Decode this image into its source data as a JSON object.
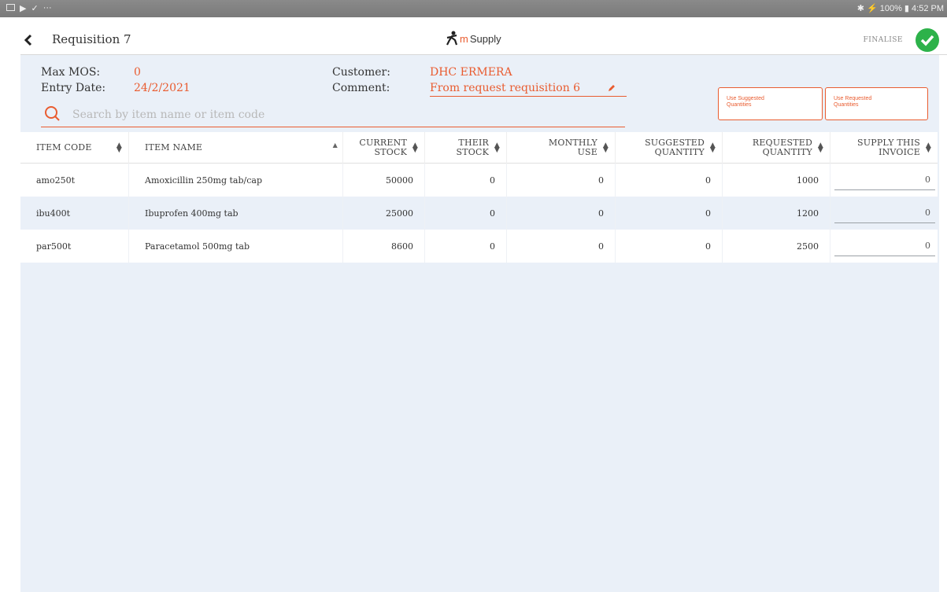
{
  "status_bar": {
    "dots": "···",
    "right_text": "✱ ⚡ 100% ▮ 4:52 PM"
  },
  "header": {
    "title": "Requisition 7",
    "logo_text_m": "m",
    "logo_text_rest": "Supply",
    "finalise_label": "FINALISE"
  },
  "info": {
    "max_mos_label": "Max MOS:",
    "max_mos_value": "0",
    "entry_date_label": "Entry Date:",
    "entry_date_value": "24/2/2021",
    "customer_label": "Customer:",
    "customer_value": "DHC ERMERA",
    "comment_label": "Comment:",
    "comment_value": "From request requisition 6"
  },
  "search": {
    "placeholder": "Search by item name or item code",
    "value": ""
  },
  "buttons": {
    "use_suggested_line1": "Use Suggested",
    "use_suggested_line2": "Quantities",
    "use_requested_line1": "Use Requested",
    "use_requested_line2": "Quantities"
  },
  "table": {
    "columns": [
      {
        "line1": "ITEM CODE",
        "line2": ""
      },
      {
        "line1": "ITEM NAME",
        "line2": ""
      },
      {
        "line1": "CURRENT",
        "line2": "STOCK"
      },
      {
        "line1": "THEIR",
        "line2": "STOCK"
      },
      {
        "line1": "MONTHLY",
        "line2": "USE"
      },
      {
        "line1": "SUGGESTED",
        "line2": "QUANTITY"
      },
      {
        "line1": "REQUESTED",
        "line2": "QUANTITY"
      },
      {
        "line1": "SUPPLY THIS",
        "line2": "INVOICE"
      }
    ],
    "rows": [
      {
        "code": "amo250t",
        "name": "Amoxicillin 250mg tab/cap",
        "current_stock": "50000",
        "their_stock": "0",
        "monthly_use": "0",
        "suggested": "0",
        "requested": "1000",
        "supply": "0"
      },
      {
        "code": "ibu400t",
        "name": "Ibuprofen 400mg tab",
        "current_stock": "25000",
        "their_stock": "0",
        "monthly_use": "0",
        "suggested": "0",
        "requested": "1200",
        "supply": "0"
      },
      {
        "code": "par500t",
        "name": "Paracetamol 500mg tab",
        "current_stock": "8600",
        "their_stock": "0",
        "monthly_use": "0",
        "suggested": "0",
        "requested": "2500",
        "supply": "0"
      }
    ]
  },
  "colors": {
    "accent": "#e95c30",
    "finalise": "#2db24a",
    "content_bg": "#eaf0f8"
  }
}
